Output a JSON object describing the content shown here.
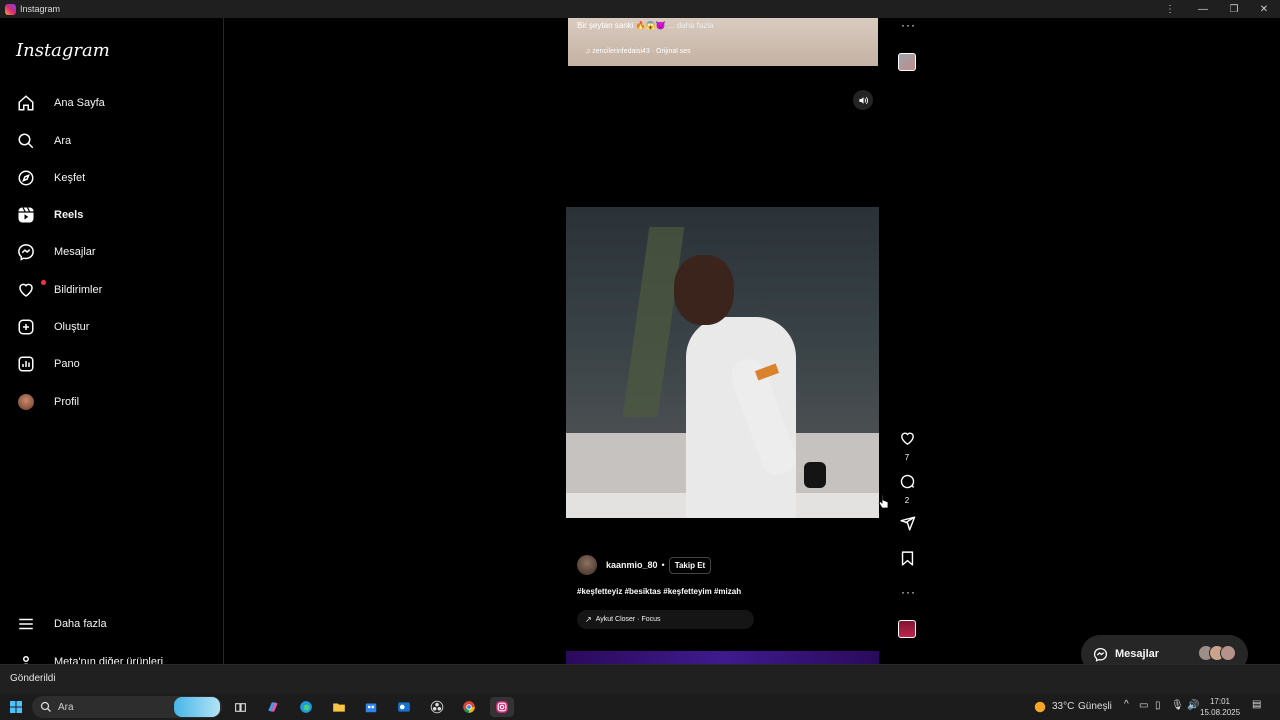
{
  "window": {
    "title": "Instagram"
  },
  "sidebar": {
    "logo": "Instagram",
    "items": [
      {
        "label": "Ana Sayfa",
        "icon": "home-icon"
      },
      {
        "label": "Ara",
        "icon": "search-icon"
      },
      {
        "label": "Keşfet",
        "icon": "compass-icon"
      },
      {
        "label": "Reels",
        "icon": "reels-icon",
        "active": true
      },
      {
        "label": "Mesajlar",
        "icon": "messenger-icon"
      },
      {
        "label": "Bildirimler",
        "icon": "heart-icon",
        "badge": true
      },
      {
        "label": "Oluştur",
        "icon": "plus-square-icon"
      },
      {
        "label": "Pano",
        "icon": "chart-icon"
      },
      {
        "label": "Profil",
        "icon": "avatar"
      }
    ],
    "more_label": "Daha fazla",
    "meta_label": "Meta'nın diğer ürünleri"
  },
  "reel_top": {
    "caption": "Bir şeytan sanki 🔥😱👿",
    "more": "... daha fazla",
    "audio": "zencilerinfedaisi43 · Orijinal ses"
  },
  "reel_main": {
    "like_count": "7",
    "comment_count": "2",
    "username": "kaanmio_80",
    "separator": "•",
    "follow_label": "Takip Et",
    "hashtags": "#keşfetteyiz #besiktas #keşfetteyim #mizah",
    "music": "Aykut Closer · Focus"
  },
  "messages_float": {
    "label": "Mesajlar"
  },
  "status": {
    "text": "Gönderildi"
  },
  "taskbar": {
    "search_label": "Ara",
    "weather": "33°C",
    "weather_desc": "Güneşli",
    "time": "17:01",
    "date": "15.08.2025"
  },
  "colors": {
    "background": "#000000",
    "notification": "#ff3040",
    "surface": "#262626"
  }
}
